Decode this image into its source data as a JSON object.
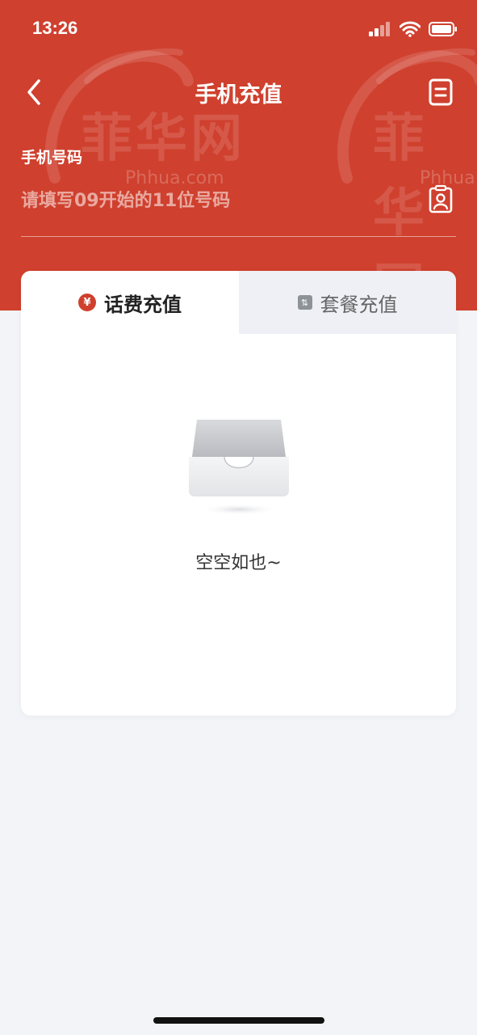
{
  "status_bar": {
    "time": "13:26"
  },
  "nav": {
    "title": "手机充值",
    "back_icon": "chevron-left-icon",
    "record_icon": "document-icon"
  },
  "phone": {
    "label": "手机号码",
    "placeholder": "请填写09开始的11位号码",
    "value": "",
    "contact_icon": "contact-book-icon"
  },
  "tabs": [
    {
      "label": "话费充值",
      "icon": "yuan-icon",
      "icon_glyph": "¥",
      "active": true
    },
    {
      "label": "套餐充值",
      "icon": "package-icon",
      "icon_glyph": "⇅",
      "active": false
    }
  ],
  "empty_state": {
    "text": "空空如也~",
    "icon": "empty-tray-icon"
  },
  "watermark": {
    "logo": "菲华网",
    "url": "Phhua.com"
  },
  "colors": {
    "brand_red": "#cf402e",
    "page_bg": "#f3f4f8",
    "tab_inactive_bg": "#eef0f5"
  }
}
